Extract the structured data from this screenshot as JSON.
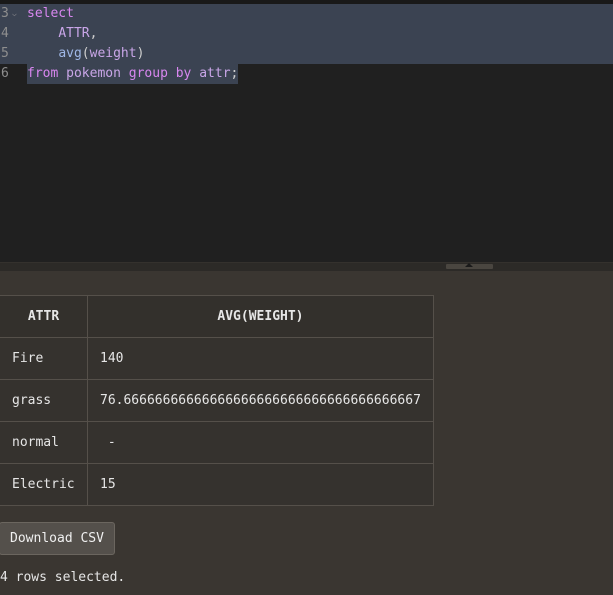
{
  "editor": {
    "lines": [
      {
        "number": "3",
        "tokens": [
          {
            "text": "select",
            "cls": "kw"
          }
        ]
      },
      {
        "number": "4",
        "tokens": [
          {
            "text": "    ",
            "cls": "pl"
          },
          {
            "text": "ATTR",
            "cls": "id"
          },
          {
            "text": ",",
            "cls": "pl"
          }
        ]
      },
      {
        "number": "5",
        "tokens": [
          {
            "text": "    ",
            "cls": "pl"
          },
          {
            "text": "avg",
            "cls": "fn"
          },
          {
            "text": "(",
            "cls": "pl"
          },
          {
            "text": "weight",
            "cls": "id"
          },
          {
            "text": ")",
            "cls": "pl"
          }
        ]
      },
      {
        "number": "6",
        "tokens": [
          {
            "text": "from",
            "cls": "kw"
          },
          {
            "text": " pokemon ",
            "cls": "id"
          },
          {
            "text": "group by",
            "cls": "kw"
          },
          {
            "text": " attr",
            "cls": "id"
          },
          {
            "text": ";",
            "cls": "pl"
          }
        ]
      }
    ]
  },
  "results": {
    "columns": [
      "ATTR",
      "AVG(WEIGHT)"
    ],
    "rows": [
      [
        "Fire",
        "140"
      ],
      [
        "grass",
        "76.66666666666666666666666666666666666667"
      ],
      [
        "normal",
        " -"
      ],
      [
        "Electric",
        "15"
      ]
    ]
  },
  "actions": {
    "download_label": "Download CSV"
  },
  "status": {
    "message": "4 rows selected."
  }
}
